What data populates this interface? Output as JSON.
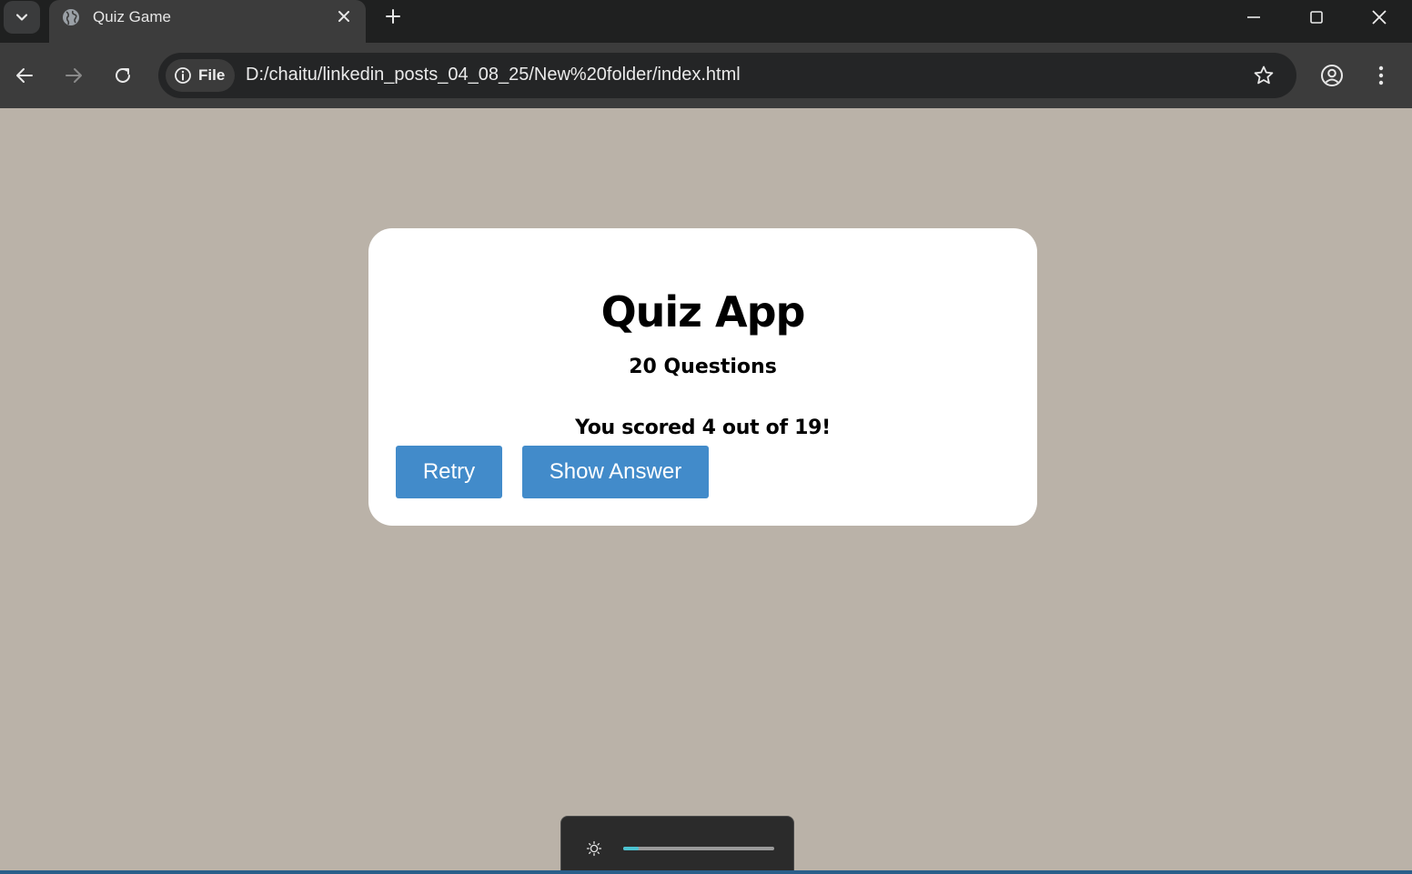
{
  "browser": {
    "tab": {
      "title": "Quiz Game",
      "favicon": "globe-icon"
    },
    "address_bar": {
      "site_chip_label": "File",
      "url": "D:/chaitu/linkedin_posts_04_08_25/New%20folder/index.html"
    },
    "icons": [
      "tab-search-icon",
      "close-icon",
      "plus-icon",
      "minimize-icon",
      "maximize-icon",
      "back-icon",
      "forward-icon",
      "reload-icon",
      "info-icon",
      "star-icon",
      "profile-icon",
      "more-icon"
    ]
  },
  "quiz": {
    "title": "Quiz App",
    "subtitle": "20 Questions",
    "score_text": "You scored 4 out of 19!",
    "retry_label": "Retry",
    "show_answer_label": "Show Answer",
    "button_color": "#428bca"
  },
  "brightness": {
    "icon": "sun-icon",
    "level": 0.1,
    "accent": "#4cc2d0"
  },
  "colors": {
    "page_bg": "#bab2a8",
    "card_bg": "#ffffff",
    "titlebar_bg": "#1f2020",
    "toolbar_bg": "#3c3c3c"
  }
}
